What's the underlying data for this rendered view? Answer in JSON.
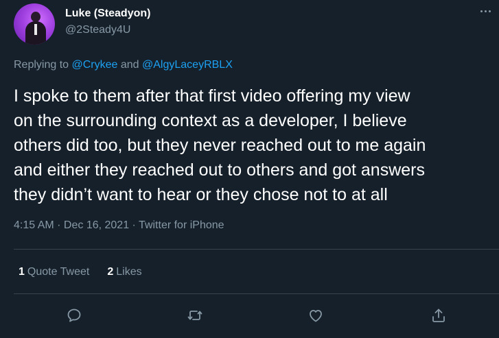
{
  "user": {
    "display_name": "Luke (Steadyon)",
    "handle": "@2Steady4U"
  },
  "reply": {
    "prefix": "Replying to ",
    "mention_1": "@Crykee",
    "joiner": " and ",
    "mention_2": "@AlgyLaceyRBLX"
  },
  "tweet": {
    "text": "I spoke to them after that first video offering my view\non the surrounding context as a developer, I believe\nothers did too, but they never reached out to me again\nand either they reached out to others and got answers\nthey didn’t want to hear or they chose not to at all"
  },
  "meta": {
    "time": "4:15 AM",
    "sep1": " · ",
    "date": "Dec 16, 2021",
    "sep2": " · ",
    "source": "Twitter for iPhone"
  },
  "stats": {
    "quote_count": "1",
    "quote_label": "Quote Tweet",
    "likes_count": "2",
    "likes_label": "Likes"
  },
  "icons": {
    "reply": "speech-bubble-icon",
    "retweet": "retweet-icon",
    "like": "heart-icon",
    "share": "share-icon",
    "more": "more-horizontal-icon"
  },
  "colors": {
    "background": "#15202b",
    "accent": "#1da1f2",
    "secondary_text": "#8899a6",
    "divider": "#38444d"
  }
}
